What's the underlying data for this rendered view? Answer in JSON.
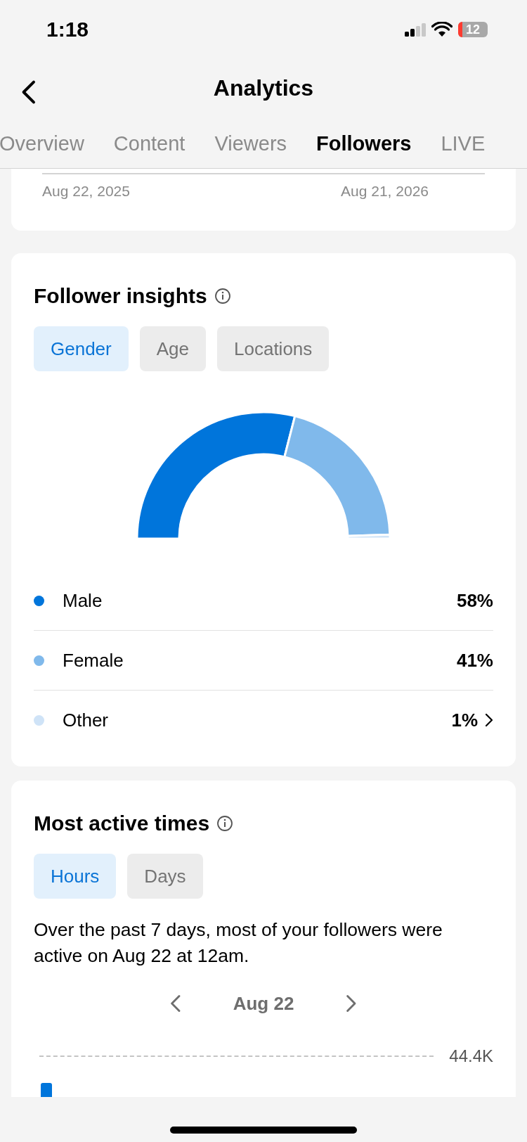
{
  "status_bar": {
    "time": "1:18",
    "battery": "12"
  },
  "header": {
    "title": "Analytics"
  },
  "tabs": [
    {
      "label": "Overview",
      "selected": false
    },
    {
      "label": "Content",
      "selected": false
    },
    {
      "label": "Viewers",
      "selected": false
    },
    {
      "label": "Followers",
      "selected": true
    },
    {
      "label": "LIVE",
      "selected": false
    }
  ],
  "range_card": {
    "start": "Aug 22, 2025",
    "end": "Aug 21, 2026"
  },
  "follower_insights": {
    "title": "Follower insights",
    "filters": [
      {
        "label": "Gender",
        "selected": true
      },
      {
        "label": "Age",
        "selected": false
      },
      {
        "label": "Locations",
        "selected": false
      }
    ],
    "chart_data": {
      "type": "donut",
      "categories": [
        "Male",
        "Female",
        "Other"
      ],
      "values": [
        58,
        41,
        1
      ]
    },
    "legend": [
      {
        "value": "58%",
        "color": "#0075db",
        "more": false
      },
      {
        "value": "41%",
        "color": "#80b9eb",
        "more": false
      },
      {
        "value": "1%",
        "color": "#cfe3f7",
        "more": true
      }
    ]
  },
  "active_times": {
    "title": "Most active times",
    "filters": [
      {
        "label": "Hours",
        "selected": true
      },
      {
        "label": "Days",
        "selected": false
      }
    ],
    "summary": "Over the past 7 days, most of your followers were active on Aug 22 at 12am.",
    "date": "Aug 22",
    "axis_max": "44.4K"
  }
}
